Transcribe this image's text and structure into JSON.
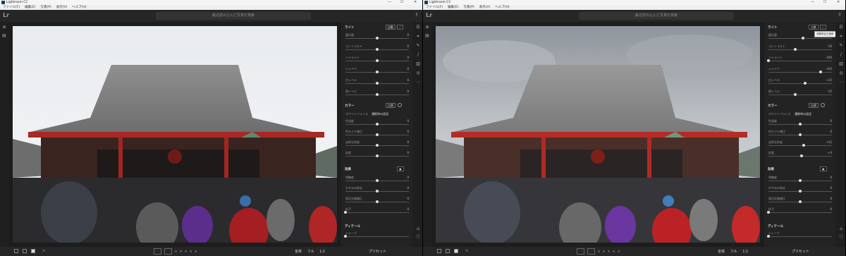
{
  "app": {
    "title": "Lightroom CC",
    "logo": "Lr",
    "window_controls": {
      "minimize": "—",
      "maximize": "☐",
      "close": "✕"
    },
    "menu": [
      "ファイル(F)",
      "編集(E)",
      "写真(P)",
      "表示(V)",
      "ヘルプ(H)"
    ],
    "search_placeholder": "最近読み込んだ写真を検索"
  },
  "colors": {
    "accent": "#dddddd",
    "panel_bg": "#232323",
    "window_bg": "#1d1d1d",
    "slider_track": "#555555"
  },
  "bottombar": {
    "zoom_options": [
      "全体",
      "フル",
      "1:1"
    ],
    "preset_label": "プリセット",
    "stars": [
      "★",
      "★",
      "★",
      "★",
      "★"
    ]
  },
  "windows": [
    {
      "light": {
        "title": "ライト",
        "auto_label": "自動",
        "sliders": [
          {
            "label": "露光量",
            "value": "0",
            "pos": 50
          },
          {
            "label": "コントラスト",
            "value": "0",
            "pos": 50
          },
          {
            "label": "ハイライト",
            "value": "0",
            "pos": 50
          },
          {
            "label": "シャドウ",
            "value": "0",
            "pos": 50
          },
          {
            "label": "白レベル",
            "value": "0",
            "pos": 50
          },
          {
            "label": "黒レベル",
            "value": "0",
            "pos": 50
          }
        ]
      },
      "color": {
        "title": "カラー",
        "bw_label": "白黒",
        "wb_label": "ホワイトバランス",
        "wb_value": "撮影時の設定",
        "sliders": [
          {
            "label": "色温度",
            "value": "0",
            "pos": 50
          },
          {
            "label": "色かぶり補正",
            "value": "0",
            "pos": 50
          },
          {
            "label": "自然な彩度",
            "value": "0",
            "pos": 50
          },
          {
            "label": "彩度",
            "value": "0",
            "pos": 50
          }
        ]
      },
      "effects": {
        "title": "効果",
        "sliders": [
          {
            "label": "明瞭度",
            "value": "0",
            "pos": 50
          },
          {
            "label": "かすみの除去",
            "value": "0",
            "pos": 50
          },
          {
            "label": "周辺光量補正",
            "value": "0",
            "pos": 50
          },
          {
            "label": "粒子",
            "value": "0",
            "pos": 0
          }
        ]
      },
      "detail_title": "ディテール",
      "detail_first": {
        "label": "シャープ",
        "value": "",
        "pos": 0
      },
      "tooltip": ""
    },
    {
      "light": {
        "title": "ライト",
        "auto_label": "自動",
        "sliders": [
          {
            "label": "露光量",
            "value": "+0.35",
            "pos": 54
          },
          {
            "label": "コントラスト",
            "value": "-16",
            "pos": 42
          },
          {
            "label": "ハイライト",
            "value": "-100",
            "pos": 0
          },
          {
            "label": "シャドウ",
            "value": "+63",
            "pos": 82
          },
          {
            "label": "白レベル",
            "value": "+15",
            "pos": 58
          },
          {
            "label": "黒レベル",
            "value": "-15",
            "pos": 42
          }
        ]
      },
      "color": {
        "title": "カラー",
        "bw_label": "白黒",
        "wb_label": "ホワイトバランス",
        "wb_value": "撮影時の設定",
        "sliders": [
          {
            "label": "色温度",
            "value": "0",
            "pos": 50
          },
          {
            "label": "色かぶり補正",
            "value": "0",
            "pos": 50
          },
          {
            "label": "自然な彩度",
            "value": "+12",
            "pos": 56
          },
          {
            "label": "彩度",
            "value": "+4",
            "pos": 52
          }
        ]
      },
      "effects": {
        "title": "効果",
        "sliders": [
          {
            "label": "明瞭度",
            "value": "0",
            "pos": 50
          },
          {
            "label": "かすみの除去",
            "value": "0",
            "pos": 50
          },
          {
            "label": "周辺光量補正",
            "value": "0",
            "pos": 50
          },
          {
            "label": "粒子",
            "value": "0",
            "pos": 0
          }
        ]
      },
      "detail_title": "ディテール",
      "detail_first": {
        "label": "シャープ",
        "value": "",
        "pos": 0
      },
      "tooltip": "自動設定を使用"
    }
  ]
}
